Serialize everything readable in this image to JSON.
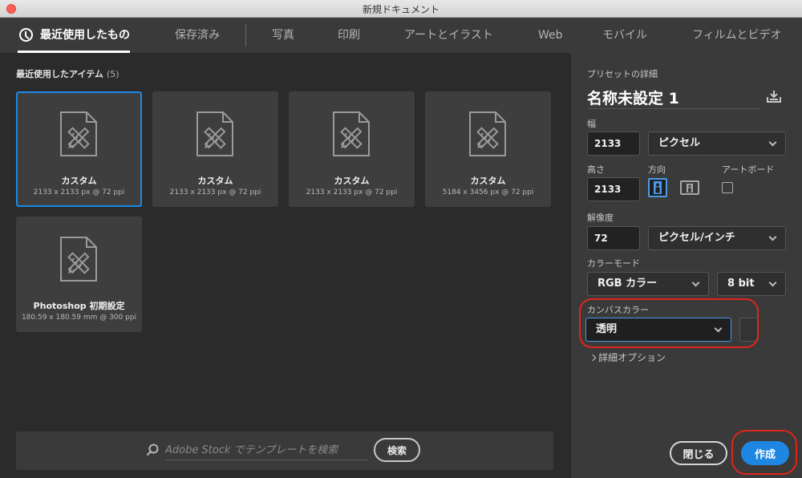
{
  "window": {
    "title": "新規ドキュメント"
  },
  "tabs": [
    {
      "label": "最近使用したもの",
      "active": true
    },
    {
      "label": "保存済み"
    },
    {
      "label": "写真"
    },
    {
      "label": "印刷"
    },
    {
      "label": "アートとイラスト"
    },
    {
      "label": "Web"
    },
    {
      "label": "モバイル"
    },
    {
      "label": "フィルムとビデオ"
    }
  ],
  "recent": {
    "title": "最近使用したアイテム",
    "count": "(5)",
    "items": [
      {
        "name": "カスタム",
        "size": "2133 x 2133 px @ 72 ppi",
        "selected": true
      },
      {
        "name": "カスタム",
        "size": "2133 x 2133 px @ 72 ppi"
      },
      {
        "name": "カスタム",
        "size": "2133 x 2133 px @ 72 ppi"
      },
      {
        "name": "カスタム",
        "size": "5184 x 3456 px @ 72 ppi"
      },
      {
        "name": "Photoshop 初期設定",
        "size": "180.59 x 180.59 mm @ 300 ppi"
      }
    ]
  },
  "search": {
    "placeholder": "Adobe Stock でテンプレートを検索",
    "button": "検索"
  },
  "preset": {
    "heading": "プリセットの詳細",
    "name": "名称未設定 1",
    "width_label": "幅",
    "width_value": "2133",
    "width_unit": "ピクセル",
    "height_label": "高さ",
    "height_value": "2133",
    "orientation_label": "方向",
    "artboard_label": "アートボード",
    "resolution_label": "解像度",
    "resolution_value": "72",
    "resolution_unit": "ピクセル/インチ",
    "color_mode_label": "カラーモード",
    "color_mode": "RGB カラー",
    "bit_depth": "8 bit",
    "canvas_color_label": "カンバスカラー",
    "canvas_color": "透明",
    "advanced_label": "詳細オプション"
  },
  "actions": {
    "close": "閉じる",
    "create": "作成"
  },
  "colors": {
    "accent": "#1d87e2",
    "highlight": "#e0251b"
  }
}
